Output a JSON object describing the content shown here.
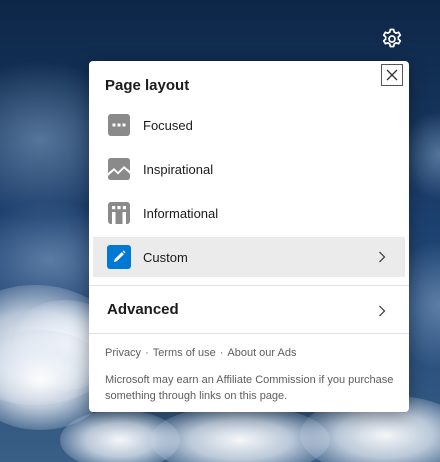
{
  "panel": {
    "title": "Page layout",
    "options": [
      {
        "label": "Focused",
        "icon": "focused-layout-icon"
      },
      {
        "label": "Inspirational",
        "icon": "inspirational-layout-icon"
      },
      {
        "label": "Informational",
        "icon": "informational-layout-icon"
      },
      {
        "label": "Custom",
        "icon": "pencil-icon",
        "selected": true
      }
    ],
    "advanced_label": "Advanced",
    "footer_links": [
      "Privacy",
      "Terms of use",
      "About our Ads"
    ],
    "link_separator": "·",
    "disclaimer": "Microsoft may earn an Affiliate Commission if you purchase something through links on this page."
  },
  "colors": {
    "accent": "#0078d4",
    "icon_gray": "#8a8a8a",
    "selected_bg": "#ebebeb"
  }
}
